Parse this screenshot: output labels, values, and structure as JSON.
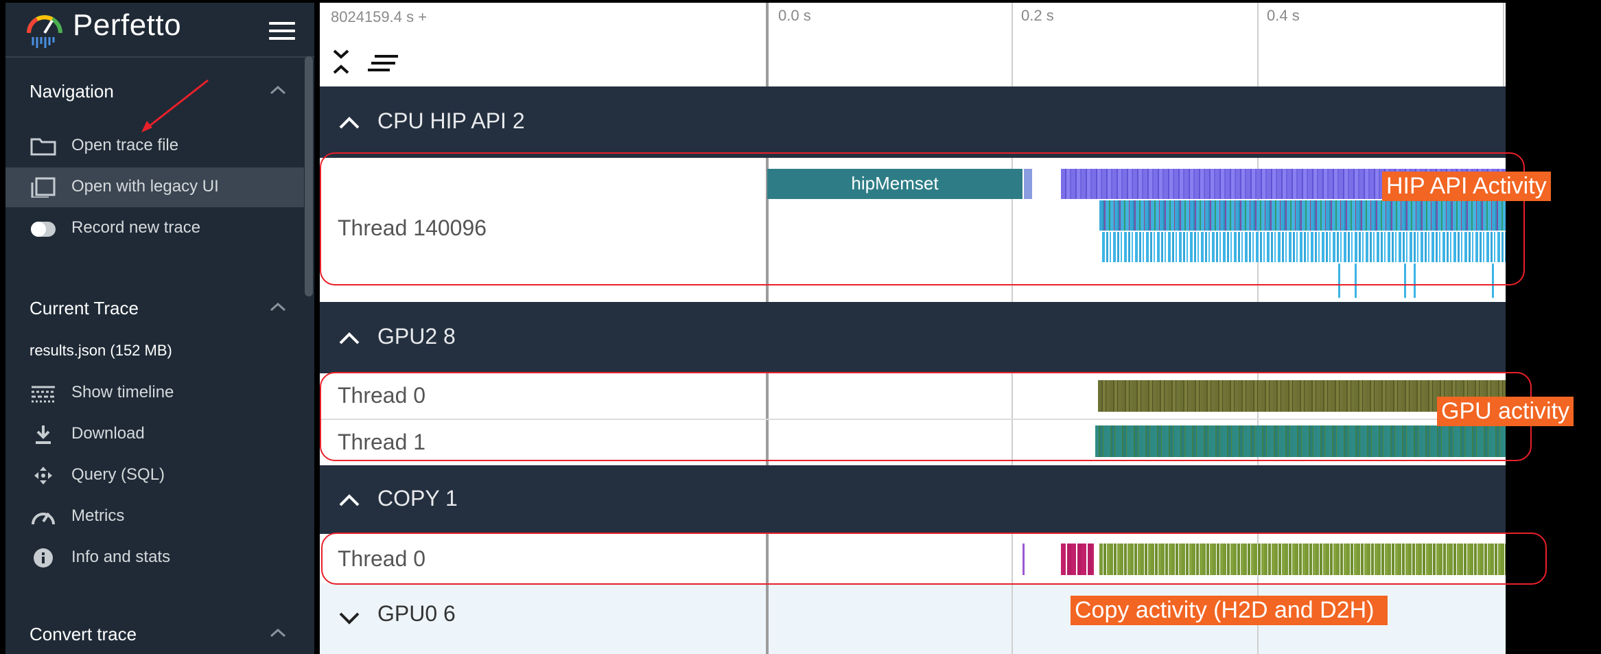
{
  "app": {
    "title": "Perfetto",
    "logo_icon": "perfetto-logo-icon",
    "menu_icon": "hamburger-menu-icon"
  },
  "sidebar": {
    "sections": [
      {
        "title": "Navigation",
        "items": [
          {
            "label": "Open trace file",
            "icon": "folder-icon"
          },
          {
            "label": "Open with legacy UI",
            "icon": "filter-none-icon",
            "active": true
          },
          {
            "label": "Record new trace",
            "icon": "toggle-icon"
          }
        ]
      },
      {
        "title": "Current Trace",
        "trace_name": "results.json (152 MB)",
        "items": [
          {
            "label": "Show timeline",
            "icon": "timeline-icon"
          },
          {
            "label": "Download",
            "icon": "download-icon"
          },
          {
            "label": "Query (SQL)",
            "icon": "query-icon"
          },
          {
            "label": "Metrics",
            "icon": "speedometer-icon"
          },
          {
            "label": "Info and stats",
            "icon": "info-icon"
          }
        ]
      },
      {
        "title": "Convert trace",
        "items": []
      }
    ]
  },
  "timeline": {
    "origin": "8024159.4 s +",
    "ticks": [
      "0.0 s",
      "0.2 s",
      "0.4 s"
    ],
    "groups": [
      {
        "title": "CPU HIP API 2",
        "expanded": true,
        "tracks": [
          {
            "name": "Thread 140096",
            "slice_label": "hipMemset"
          }
        ]
      },
      {
        "title": "GPU2 8",
        "expanded": true,
        "tracks": [
          {
            "name": "Thread 0"
          },
          {
            "name": "Thread 1"
          }
        ]
      },
      {
        "title": "COPY 1",
        "expanded": true,
        "tracks": [
          {
            "name": "Thread 0"
          }
        ]
      },
      {
        "title": "GPU0 6",
        "expanded": false,
        "tracks": []
      }
    ]
  },
  "annotations": {
    "hip_api": "HIP API Activity",
    "gpu": "GPU activity",
    "copy": "Copy activity (H2D and D2H)",
    "box_color": "#e8202a",
    "label_bg": "#f26522"
  },
  "colors": {
    "sidebar_bg": "#1f2a36",
    "group_header_bg": "#243040",
    "hipMemset_slice": "#2e7d86"
  }
}
